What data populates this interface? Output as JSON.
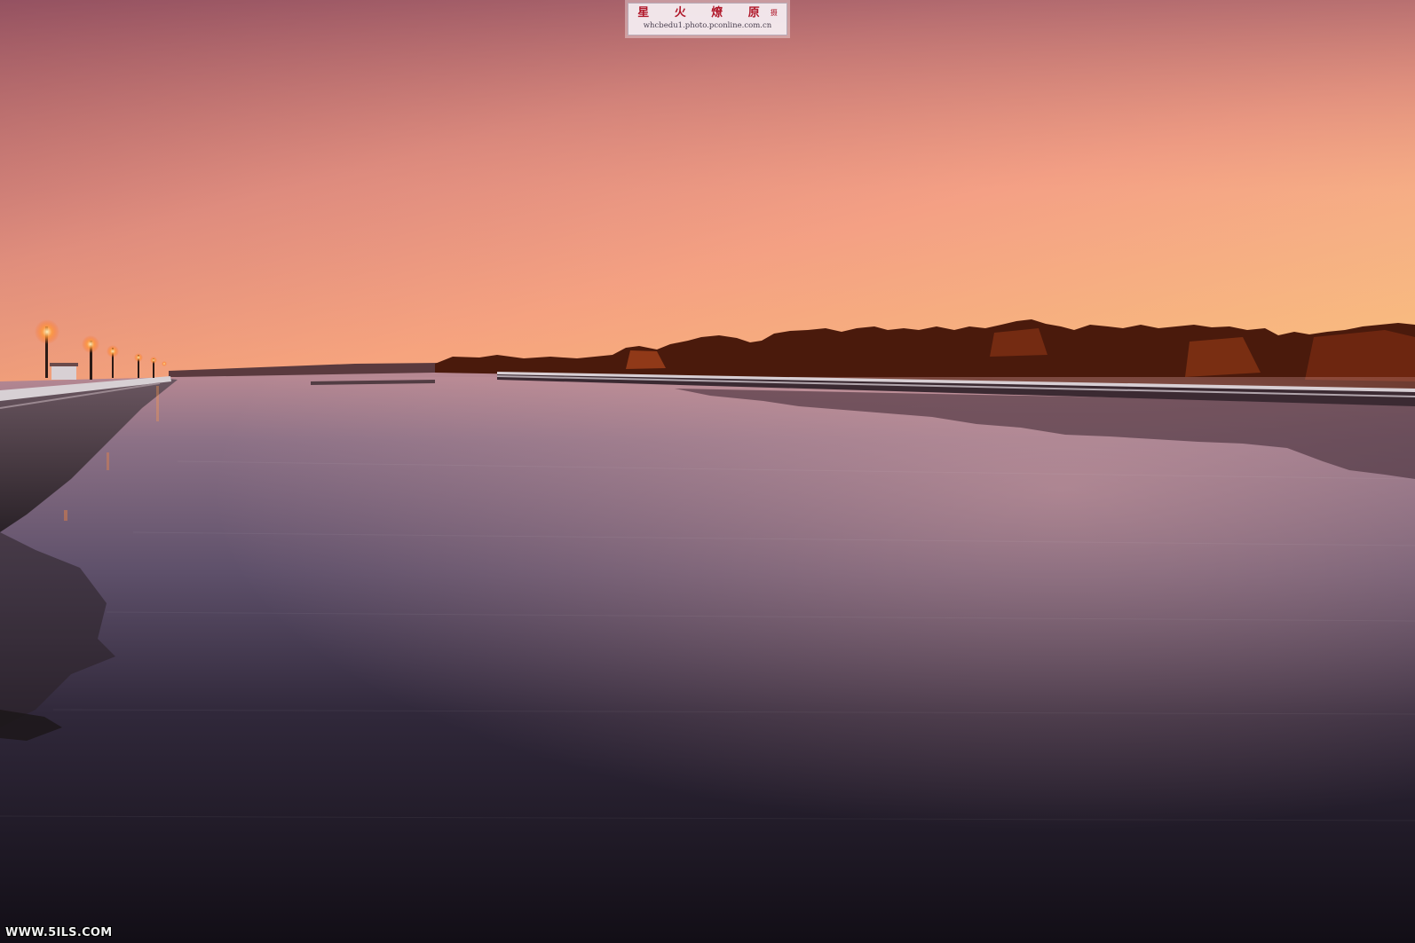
{
  "watermark": {
    "title": "星 火 燎 原",
    "title_suffix": "摄",
    "url": "whcbedu1.photo.pconline.com.cn"
  },
  "site_mark": "WWW.5ILS.COM",
  "colors": {
    "sky_top": "#a4616b",
    "sky_horizon": "#f7b46f",
    "water_mid": "#6a5a74",
    "water_bottom": "#100c14",
    "trees": "#4a1a0c",
    "railing": "#d8cfd4"
  }
}
